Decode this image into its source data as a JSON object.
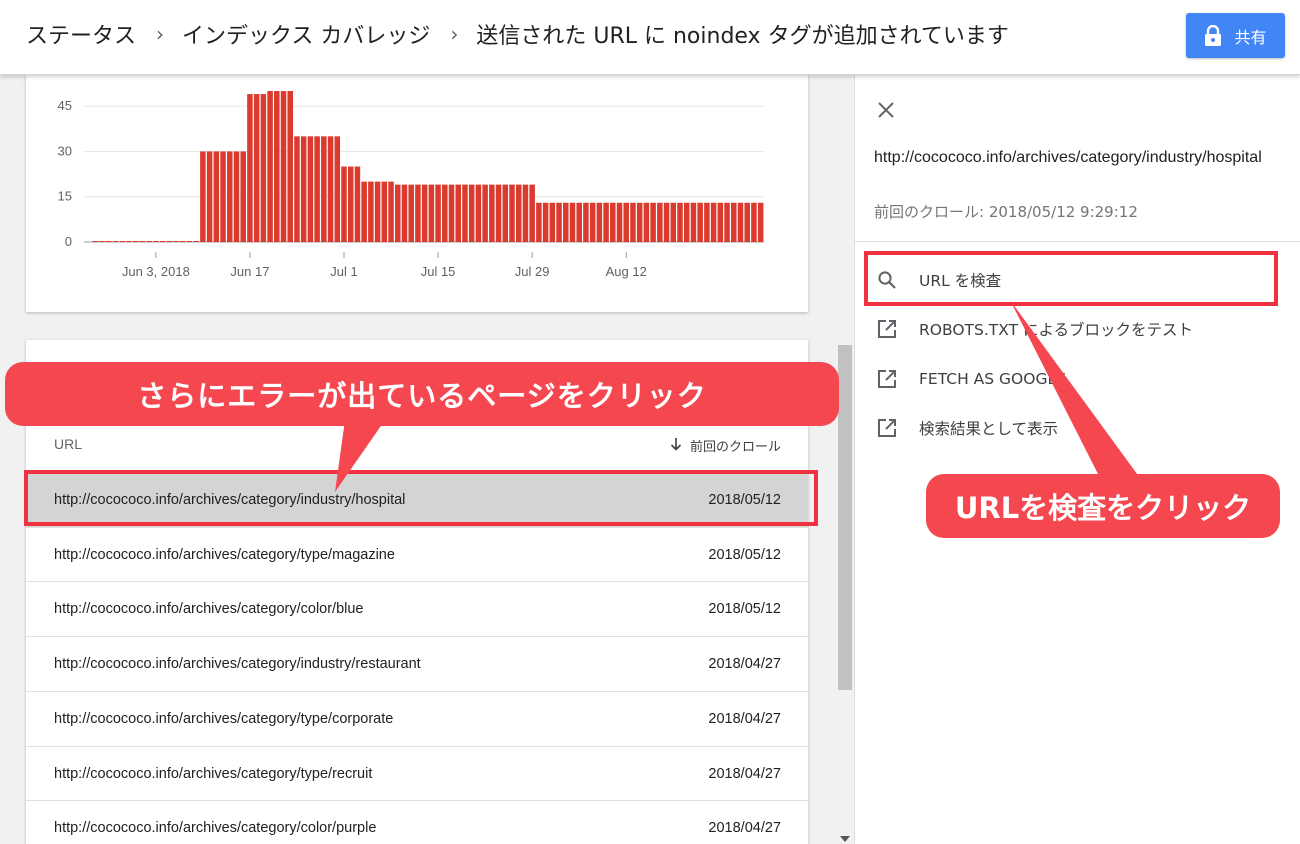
{
  "header": {
    "breadcrumb": [
      "ステータス",
      "インデックス カバレッジ",
      "送信された URL に noindex タグが追加されています"
    ],
    "separator": "›",
    "share_label": "共有"
  },
  "chart_data": {
    "type": "bar",
    "title": "",
    "xlabel": "",
    "ylabel": "",
    "ylim": [
      0,
      52
    ],
    "yticks": [
      0,
      15,
      30,
      45
    ],
    "ytick_labels": [
      "0",
      "15",
      "30",
      "45"
    ],
    "xtick_labels": [
      "Jun 3, 2018",
      "Jun 17",
      "Jul 1",
      "Jul 15",
      "Jul 29",
      "Aug 12"
    ],
    "xtick_positions": [
      9,
      23,
      37,
      51,
      65,
      79
    ],
    "grid": true,
    "color": "#db3b2f",
    "values": [
      0,
      0,
      0,
      0,
      0,
      0,
      0,
      0,
      0,
      0,
      0,
      0,
      0,
      0,
      0,
      0,
      30,
      30,
      30,
      30,
      30,
      30,
      30,
      49,
      49,
      49,
      50,
      50,
      50,
      50,
      35,
      35,
      35,
      35,
      35,
      35,
      35,
      25,
      25,
      25,
      20,
      20,
      20,
      20,
      20,
      19,
      19,
      19,
      19,
      19,
      19,
      19,
      19,
      19,
      19,
      19,
      19,
      19,
      19,
      19,
      19,
      19,
      19,
      19,
      19,
      19,
      13,
      13,
      13,
      13,
      13,
      13,
      13,
      13,
      13,
      13,
      13,
      13,
      13,
      13,
      13,
      13,
      13,
      13,
      13,
      13,
      13,
      13,
      13,
      13,
      13,
      13,
      13,
      13,
      13,
      13,
      13,
      13,
      13,
      13
    ]
  },
  "table": {
    "col_url": "URL",
    "col_crawl": "前回のクロール",
    "sort_icon": "arrow-down-icon",
    "rows": [
      {
        "url": "http://cocococo.info/archives/category/industry/hospital",
        "date": "2018/05/12"
      },
      {
        "url": "http://cocococo.info/archives/category/type/magazine",
        "date": "2018/05/12"
      },
      {
        "url": "http://cocococo.info/archives/category/color/blue",
        "date": "2018/05/12"
      },
      {
        "url": "http://cocococo.info/archives/category/industry/restaurant",
        "date": "2018/04/27"
      },
      {
        "url": "http://cocococo.info/archives/category/type/corporate",
        "date": "2018/04/27"
      },
      {
        "url": "http://cocococo.info/archives/category/type/recruit",
        "date": "2018/04/27"
      },
      {
        "url": "http://cocococo.info/archives/category/color/purple",
        "date": "2018/04/27"
      }
    ]
  },
  "panel": {
    "url": "http://cocococo.info/archives/category/industry/hospital",
    "last_crawl": "前回のクロール: 2018/05/12 9:29:12",
    "actions": [
      {
        "icon": "search-icon",
        "label": "URL を検査"
      },
      {
        "icon": "open-in-new-icon",
        "label": "ROBOTS.TXT によるブロックをテスト"
      },
      {
        "icon": "open-in-new-icon",
        "label": "FETCH AS GOOGLE"
      },
      {
        "icon": "open-in-new-icon",
        "label": "検索結果として表示"
      }
    ]
  },
  "annotations": {
    "left_callout": "さらにエラーが出ているページをクリック",
    "right_callout": "URLを検査をクリック",
    "color": "#f5474f"
  }
}
